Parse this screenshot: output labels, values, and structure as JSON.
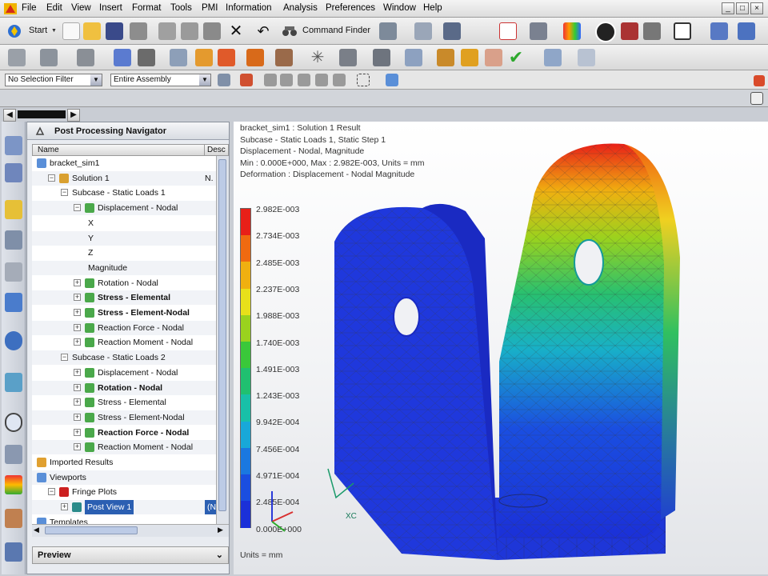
{
  "menu": {
    "items": [
      "File",
      "Edit",
      "View",
      "Insert",
      "Format",
      "Tools",
      "PMI",
      "Information",
      "Analysis",
      "Preferences",
      "Window",
      "Help"
    ],
    "window_buttons": [
      "_",
      "□",
      "×"
    ]
  },
  "toolbar": {
    "start_label": "Start",
    "command_finder_label": "Command Finder"
  },
  "selection": {
    "filter_value": "No Selection Filter",
    "scope_value": "Entire Assembly"
  },
  "navigator": {
    "title": "Post Processing Navigator",
    "columns": [
      "Name",
      "Desc"
    ],
    "rows": [
      {
        "label": "bracket_sim1",
        "desc": ""
      },
      {
        "label": "Solution 1",
        "desc": "N."
      },
      {
        "label": "Subcase - Static Loads 1",
        "desc": ""
      },
      {
        "label": "Displacement - Nodal",
        "desc": ""
      },
      {
        "label": "X",
        "desc": ""
      },
      {
        "label": "Y",
        "desc": ""
      },
      {
        "label": "Z",
        "desc": ""
      },
      {
        "label": "Magnitude",
        "desc": ""
      },
      {
        "label": "Rotation - Nodal",
        "desc": ""
      },
      {
        "label": "Stress - Elemental",
        "desc": ""
      },
      {
        "label": "Stress - Element-Nodal",
        "desc": ""
      },
      {
        "label": "Reaction Force - Nodal",
        "desc": ""
      },
      {
        "label": "Reaction Moment - Nodal",
        "desc": ""
      },
      {
        "label": "Subcase - Static Loads 2",
        "desc": ""
      },
      {
        "label": "Displacement - Nodal",
        "desc": ""
      },
      {
        "label": "Rotation - Nodal",
        "desc": ""
      },
      {
        "label": "Stress - Elemental",
        "desc": ""
      },
      {
        "label": "Stress - Element-Nodal",
        "desc": ""
      },
      {
        "label": "Reaction Force - Nodal",
        "desc": ""
      },
      {
        "label": "Reaction Moment - Nodal",
        "desc": ""
      },
      {
        "label": "Imported Results",
        "desc": ""
      },
      {
        "label": "Viewports",
        "desc": ""
      },
      {
        "label": "Fringe Plots",
        "desc": ""
      },
      {
        "label": "Post View 1",
        "desc": "(N"
      },
      {
        "label": "Templates",
        "desc": ""
      }
    ],
    "preview_label": "Preview"
  },
  "viewport": {
    "info_lines": [
      "bracket_sim1 : Solution 1 Result",
      "Subcase - Static Loads 1, Static Step 1",
      "Displacement - Nodal, Magnitude",
      "Min : 0.000E+000, Max : 2.982E-003, Units = mm",
      "Deformation : Displacement - Nodal Magnitude"
    ],
    "legend_values": [
      "2.982E-003",
      "2.734E-003",
      "2.485E-003",
      "2.237E-003",
      "1.988E-003",
      "1.740E-003",
      "1.491E-003",
      "1.243E-003",
      "9.942E-004",
      "7.456E-004",
      "4.971E-004",
      "2.485E-004",
      "0.000E+000"
    ],
    "units_label": "Units = mm",
    "triad_label": "XC",
    "colors": {
      "max": "#e8201c",
      "min": "#1a2cd6"
    }
  }
}
